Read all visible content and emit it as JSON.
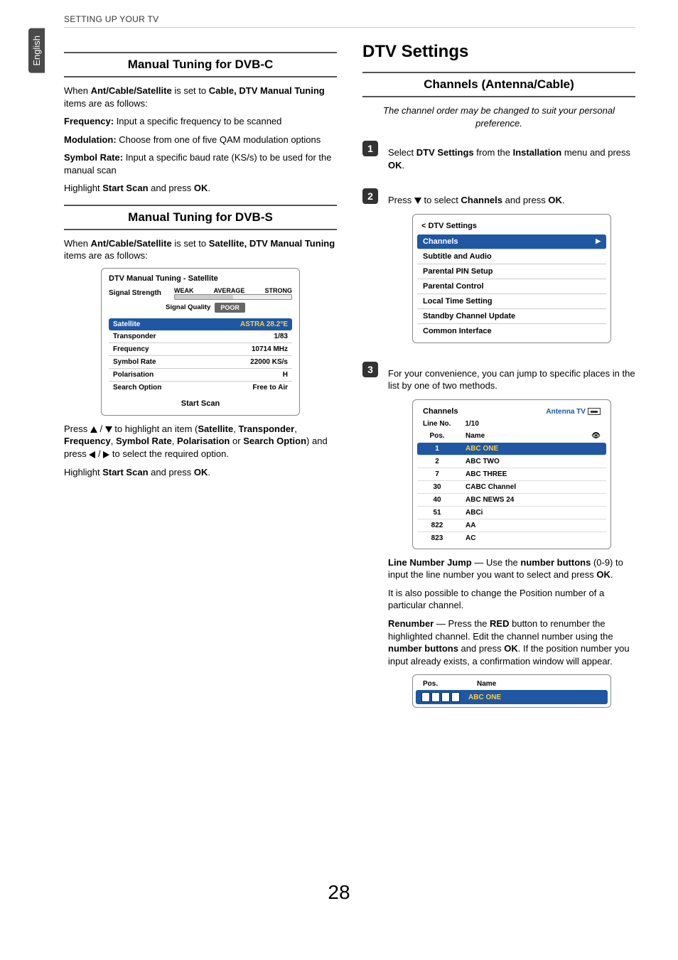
{
  "meta": {
    "language_tab": "English",
    "running_head": "SETTING UP YOUR TV",
    "page_number": "28"
  },
  "left": {
    "heading_dvbc": "Manual Tuning for DVB-C",
    "p_dvbc_intro_pre": "When ",
    "p_dvbc_intro_b1": "Ant/Cable/Satellite",
    "p_dvbc_intro_mid": " is set to ",
    "p_dvbc_intro_b2": "Cable, DTV Manual Tuning",
    "p_dvbc_intro_post": " items are as follows:",
    "freq_label": "Frequency:",
    "freq_text": " Input a specific frequency to be scanned",
    "mod_label": "Modulation:",
    "mod_text": " Choose from one of five QAM modulation options",
    "sym_label": "Symbol Rate:",
    "sym_text": " Input a specific baud rate (KS/s) to be used for the manual scan",
    "p_highlight1_pre": "Highlight ",
    "p_highlight1_b": "Start Scan",
    "p_highlight1_mid": " and press ",
    "p_highlight1_b2": "OK",
    "p_highlight1_post": ".",
    "heading_dvbs": "Manual Tuning for DVB-S",
    "p_dvbs_intro_pre": "When ",
    "p_dvbs_intro_b1": "Ant/Cable/Satellite",
    "p_dvbs_intro_mid": " is set to ",
    "p_dvbs_intro_b2": "Satellite, DTV Manual Tuning",
    "p_dvbs_intro_post": " items are as follows:",
    "osd_sat": {
      "title": "DTV Manual Tuning - Satellite",
      "sig_strength": "Signal Strength",
      "tags": [
        "WEAK",
        "AVERAGE",
        "STRONG"
      ],
      "sig_quality": "Signal Quality",
      "poor": "POOR",
      "rows": [
        {
          "k": "Satellite",
          "v": "ASTRA 28.2°E"
        },
        {
          "k": "Transponder",
          "v": "1/83"
        },
        {
          "k": "Frequency",
          "v": "10714 MHz"
        },
        {
          "k": "Symbol Rate",
          "v": "22000 KS/s"
        },
        {
          "k": "Polarisation",
          "v": "H"
        },
        {
          "k": "Search Option",
          "v": "Free to Air"
        }
      ],
      "start": "Start Scan"
    },
    "p_press_pre": "Press ",
    "p_press_mid1": " / ",
    "p_press_mid2": " to highlight an item (",
    "p_press_items": [
      "Satellite",
      "Transponder",
      "Frequency",
      "Symbol Rate",
      "Polarisation",
      "Search Option"
    ],
    "p_press_mid3": ") and press ",
    "p_press_mid4": " / ",
    "p_press_mid5": " to select the required option.",
    "or_word": " or "
  },
  "right": {
    "h1": "DTV Settings",
    "sub_heading": "Channels (Antenna/Cable)",
    "intro_italic": "The channel order may be changed to suit your personal preference.",
    "step1_pre": "Select ",
    "step1_b1": "DTV Settings",
    "step1_mid": " from the ",
    "step1_b2": "Installation",
    "step1_mid2": " menu and press ",
    "step1_b3": "OK",
    "step1_post": ".",
    "step2_pre": "Press ",
    "step2_mid": " to select ",
    "step2_b1": "Channels",
    "step2_mid2": " and press ",
    "step2_b2": "OK",
    "step2_post": ".",
    "dtv_menu": {
      "title": "< DTV Settings",
      "items": [
        "Channels",
        "Subtitle and Audio",
        "Parental PIN Setup",
        "Parental Control",
        "Local Time Setting",
        "Standby Channel Update",
        "Common Interface"
      ]
    },
    "step3_text": "For your convenience, you can jump to specific places in the list by one of two methods.",
    "ch_box": {
      "title": "Channels",
      "ant": "Antenna TV",
      "line_no_label": "Line No.",
      "line_no_val": "1/10",
      "pos": "Pos.",
      "name": "Name",
      "rows": [
        {
          "p": "1",
          "n": "ABC ONE"
        },
        {
          "p": "2",
          "n": "ABC TWO"
        },
        {
          "p": "7",
          "n": "ABC THREE"
        },
        {
          "p": "30",
          "n": "CABC Channel"
        },
        {
          "p": "40",
          "n": "ABC NEWS 24"
        },
        {
          "p": "51",
          "n": "ABCi"
        },
        {
          "p": "822",
          "n": "AA"
        },
        {
          "p": "823",
          "n": "AC"
        }
      ]
    },
    "lnj_b": "Line Number Jump",
    "lnj_mid": " — Use the ",
    "lnj_b2": "number buttons",
    "lnj_mid2": " (0-9) to input the line number you want to select and press ",
    "lnj_b3": "OK",
    "lnj_post": ".",
    "lnj_p2": "It is also possible to change the Position number of a particular channel.",
    "ren_b": "Renumber",
    "ren_mid": " — Press the ",
    "ren_b2": "RED",
    "ren_mid2": " button to renumber the highlighted channel. Edit the channel number using the ",
    "ren_b3": "number buttons",
    "ren_mid3": " and press ",
    "ren_b4": "OK",
    "ren_mid4": ". If the position number you input already exists, a confirmation window will appear.",
    "ren_box": {
      "pos": "Pos.",
      "name": "Name",
      "ch_name": "ABC ONE"
    }
  }
}
